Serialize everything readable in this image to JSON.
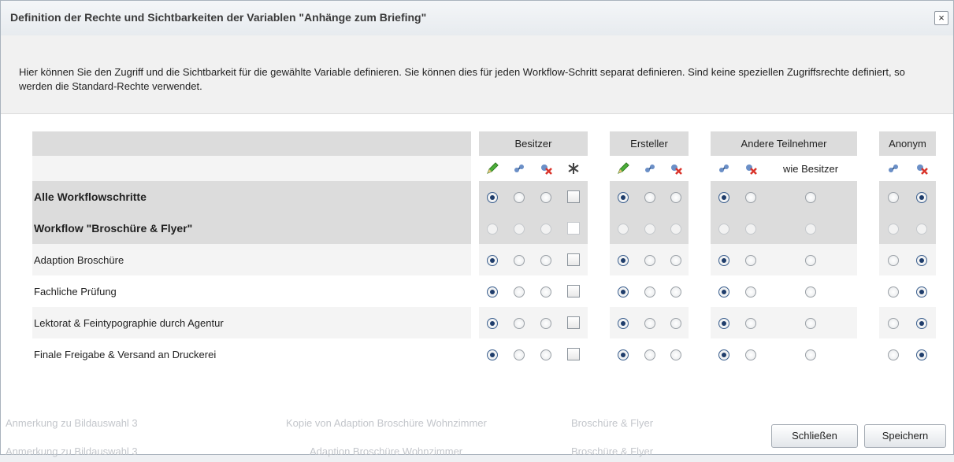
{
  "dialog": {
    "title": "Definition der Rechte und Sichtbarkeiten der Variablen \"Anhänge zum Briefing\"",
    "close_label": "×",
    "info_text": "Hier können Sie den Zugriff und die Sichtbarkeit für die gewählte Variable definieren. Sie können dies für jeden Workflow-Schritt separat definieren. Sind keine speziellen Zugriffsrechte definiert, so werden die Standard-Rechte verwendet."
  },
  "table": {
    "groups": {
      "besitzer": "Besitzer",
      "ersteller": "Ersteller",
      "andere": "Andere Teilnehmer",
      "anonym": "Anonym"
    },
    "wie_besitzer": "wie Besitzer",
    "rows": [
      {
        "label": "Alle Workflowschritte"
      },
      {
        "label": "Workflow \"Broschüre & Flyer\""
      },
      {
        "label": "Adaption Broschüre"
      },
      {
        "label": "Fachliche Prüfung"
      },
      {
        "label": "Lektorat & Feintypographie durch Agentur"
      },
      {
        "label": "Finale Freigabe & Versand an Druckerei"
      }
    ]
  },
  "background": {
    "row1_a": "Anmerkung zu Bildauswahl 3",
    "row1_b": "Kopie von Adaption Broschüre Wohnzimmer",
    "row1_c": "Broschüre & Flyer",
    "row2_a": "Anmerkung zu Bildauswahl 3",
    "row2_b": "Adaption Broschüre Wohnzimmer",
    "row2_c": "Broschüre & Flyer"
  },
  "buttons": {
    "close": "Schließen",
    "save": "Speichern"
  },
  "icons": [
    "pencil-icon",
    "visibility-icon",
    "hidden-icon",
    "asterisk-icon"
  ]
}
